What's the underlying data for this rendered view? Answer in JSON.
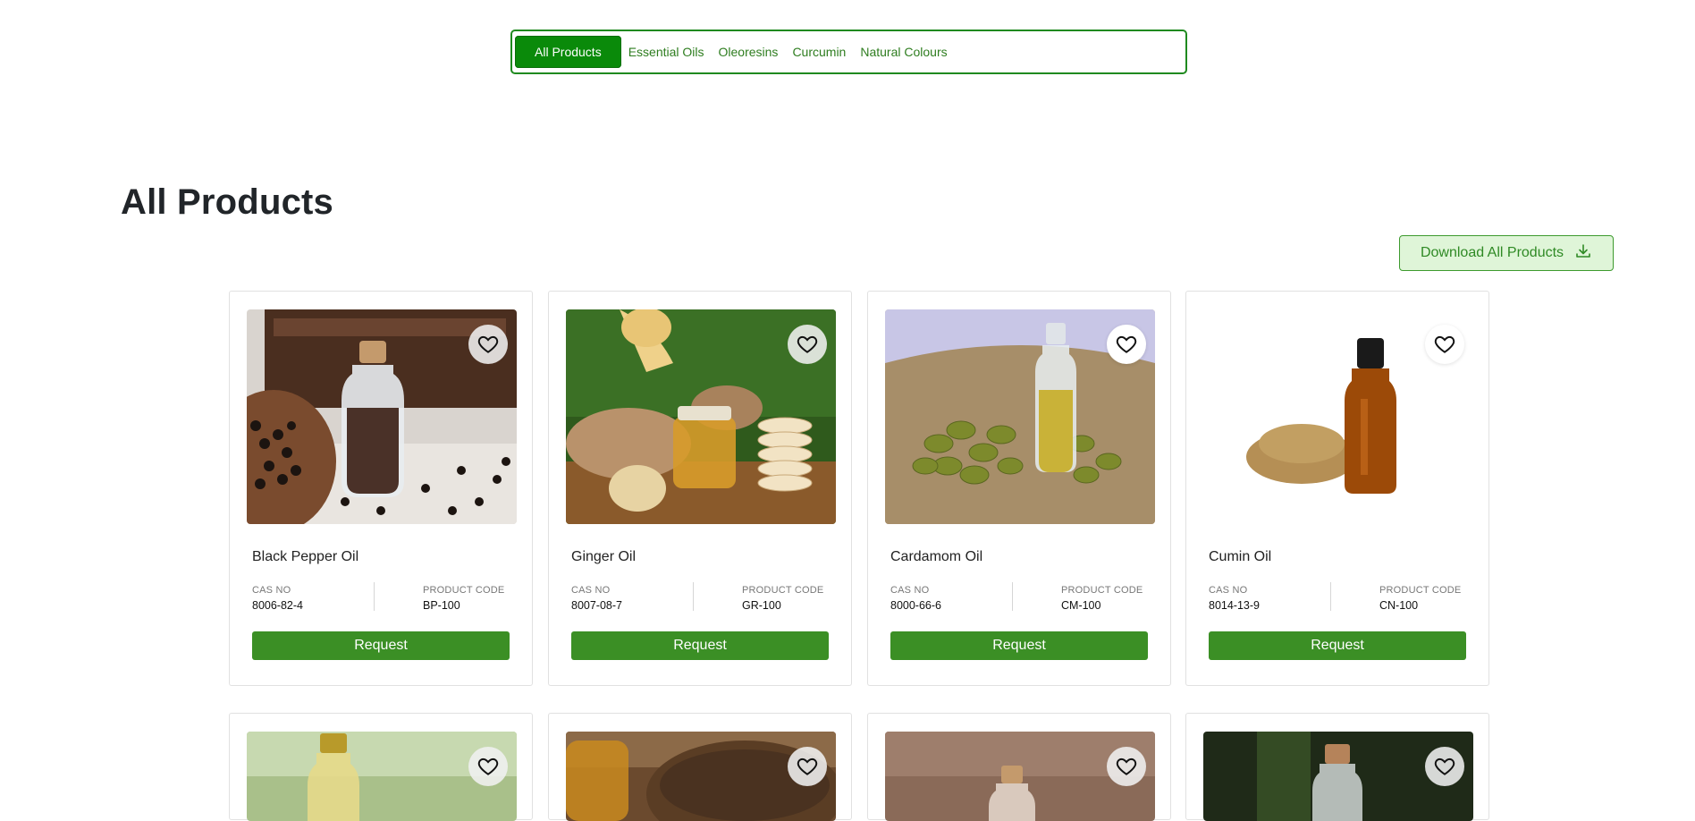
{
  "tabs": [
    {
      "label": "All Products",
      "active": true
    },
    {
      "label": "Essential Oils"
    },
    {
      "label": "Oleoresins"
    },
    {
      "label": "Curcumin"
    },
    {
      "label": "Natural Colours"
    }
  ],
  "page": {
    "title": "All Products",
    "download_label": "Download All Products"
  },
  "labels": {
    "cas": "CAS NO",
    "code": "PRODUCT CODE",
    "request": "Request"
  },
  "products": [
    {
      "name": "Black Pepper Oil",
      "cas": "8006-82-4",
      "code": "BP-100"
    },
    {
      "name": "Ginger Oil",
      "cas": "8007-08-7",
      "code": "GR-100"
    },
    {
      "name": "Cardamom Oil",
      "cas": "8000-66-6",
      "code": "CM-100"
    },
    {
      "name": "Cumin Oil",
      "cas": "8014-13-9",
      "code": "CN-100"
    }
  ],
  "colors": {
    "brand_green": "#3b8f25",
    "tab_active": "#0a8a0a",
    "download_bg": "#dff5d8"
  }
}
